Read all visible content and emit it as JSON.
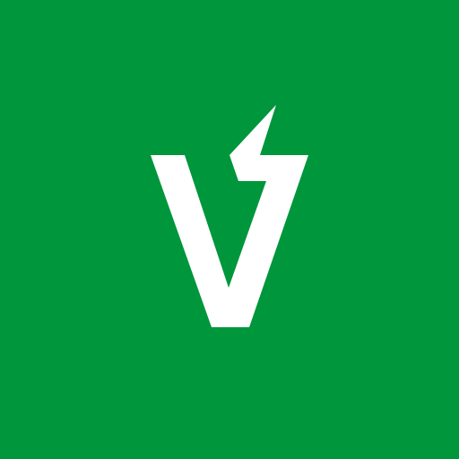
{
  "icon": {
    "name": "lightning-v-logo-icon",
    "background_color": "#00963b",
    "foreground_color": "#ffffff"
  }
}
